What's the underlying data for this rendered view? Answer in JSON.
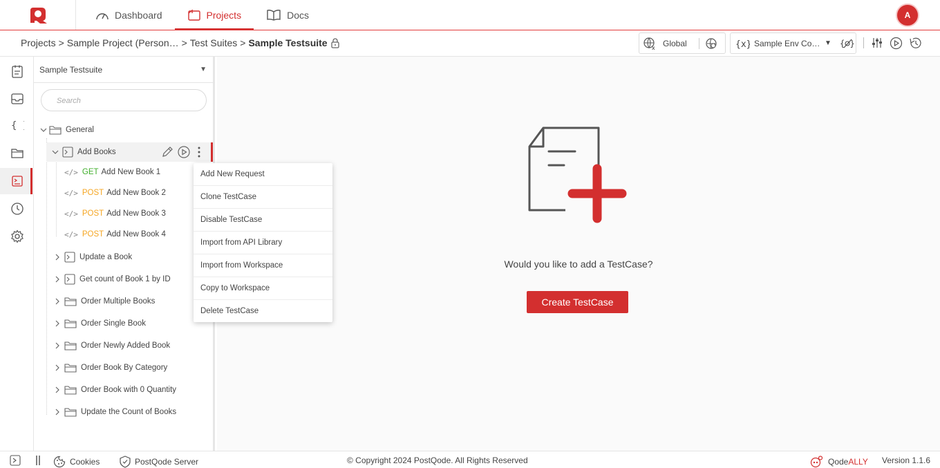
{
  "nav": {
    "items": [
      {
        "label": "Dashboard",
        "icon": "gauge-icon"
      },
      {
        "label": "Projects",
        "icon": "projects-icon"
      },
      {
        "label": "Docs",
        "icon": "book-icon"
      }
    ],
    "active": "Projects",
    "avatar_initial": "A"
  },
  "breadcrumb": {
    "items": [
      "Projects",
      "Sample Project (Person…",
      "Test Suites",
      "Sample Testsuite"
    ],
    "separator": ">"
  },
  "env": {
    "global_label": "Global",
    "env_label": "Sample Env Co…"
  },
  "sidebar": {
    "suite_name": "Sample Testsuite",
    "search_placeholder": "Search"
  },
  "tree": {
    "root": "General",
    "selected_case": "Add Books",
    "requests": [
      {
        "method": "GET",
        "name": "Add New Book 1"
      },
      {
        "method": "POST",
        "name": "Add New Book 2"
      },
      {
        "method": "POST",
        "name": "Add New Book 3"
      },
      {
        "method": "POST",
        "name": "Add New Book 4"
      }
    ],
    "cases": [
      "Update a Book",
      "Get count of Book 1 by ID"
    ],
    "folders": [
      "Order Multiple Books",
      "Order Single Book",
      "Order Newly Added Book",
      "Order Book By Category",
      "Order Book with 0 Quantity",
      "Update the Count of Books"
    ]
  },
  "context_menu": {
    "items": [
      "Add New Request",
      "Clone TestCase",
      "Disable TestCase",
      "Import from API Library",
      "Import from Workspace",
      "Copy to Workspace",
      "Delete TestCase"
    ]
  },
  "main": {
    "prompt": "Would you like to add a TestCase?",
    "create_button": "Create TestCase"
  },
  "footer": {
    "cookies": "Cookies",
    "server": "PostQode Server",
    "copyright": "© Copyright 2024 PostQode. All Rights Reserved",
    "brand_prefix": "Qode",
    "brand_suffix": "ALLY",
    "version": "Version 1.1.6"
  },
  "colors": {
    "accent": "#d32f2f",
    "get": "#3fae2a",
    "post": "#f5a623"
  }
}
